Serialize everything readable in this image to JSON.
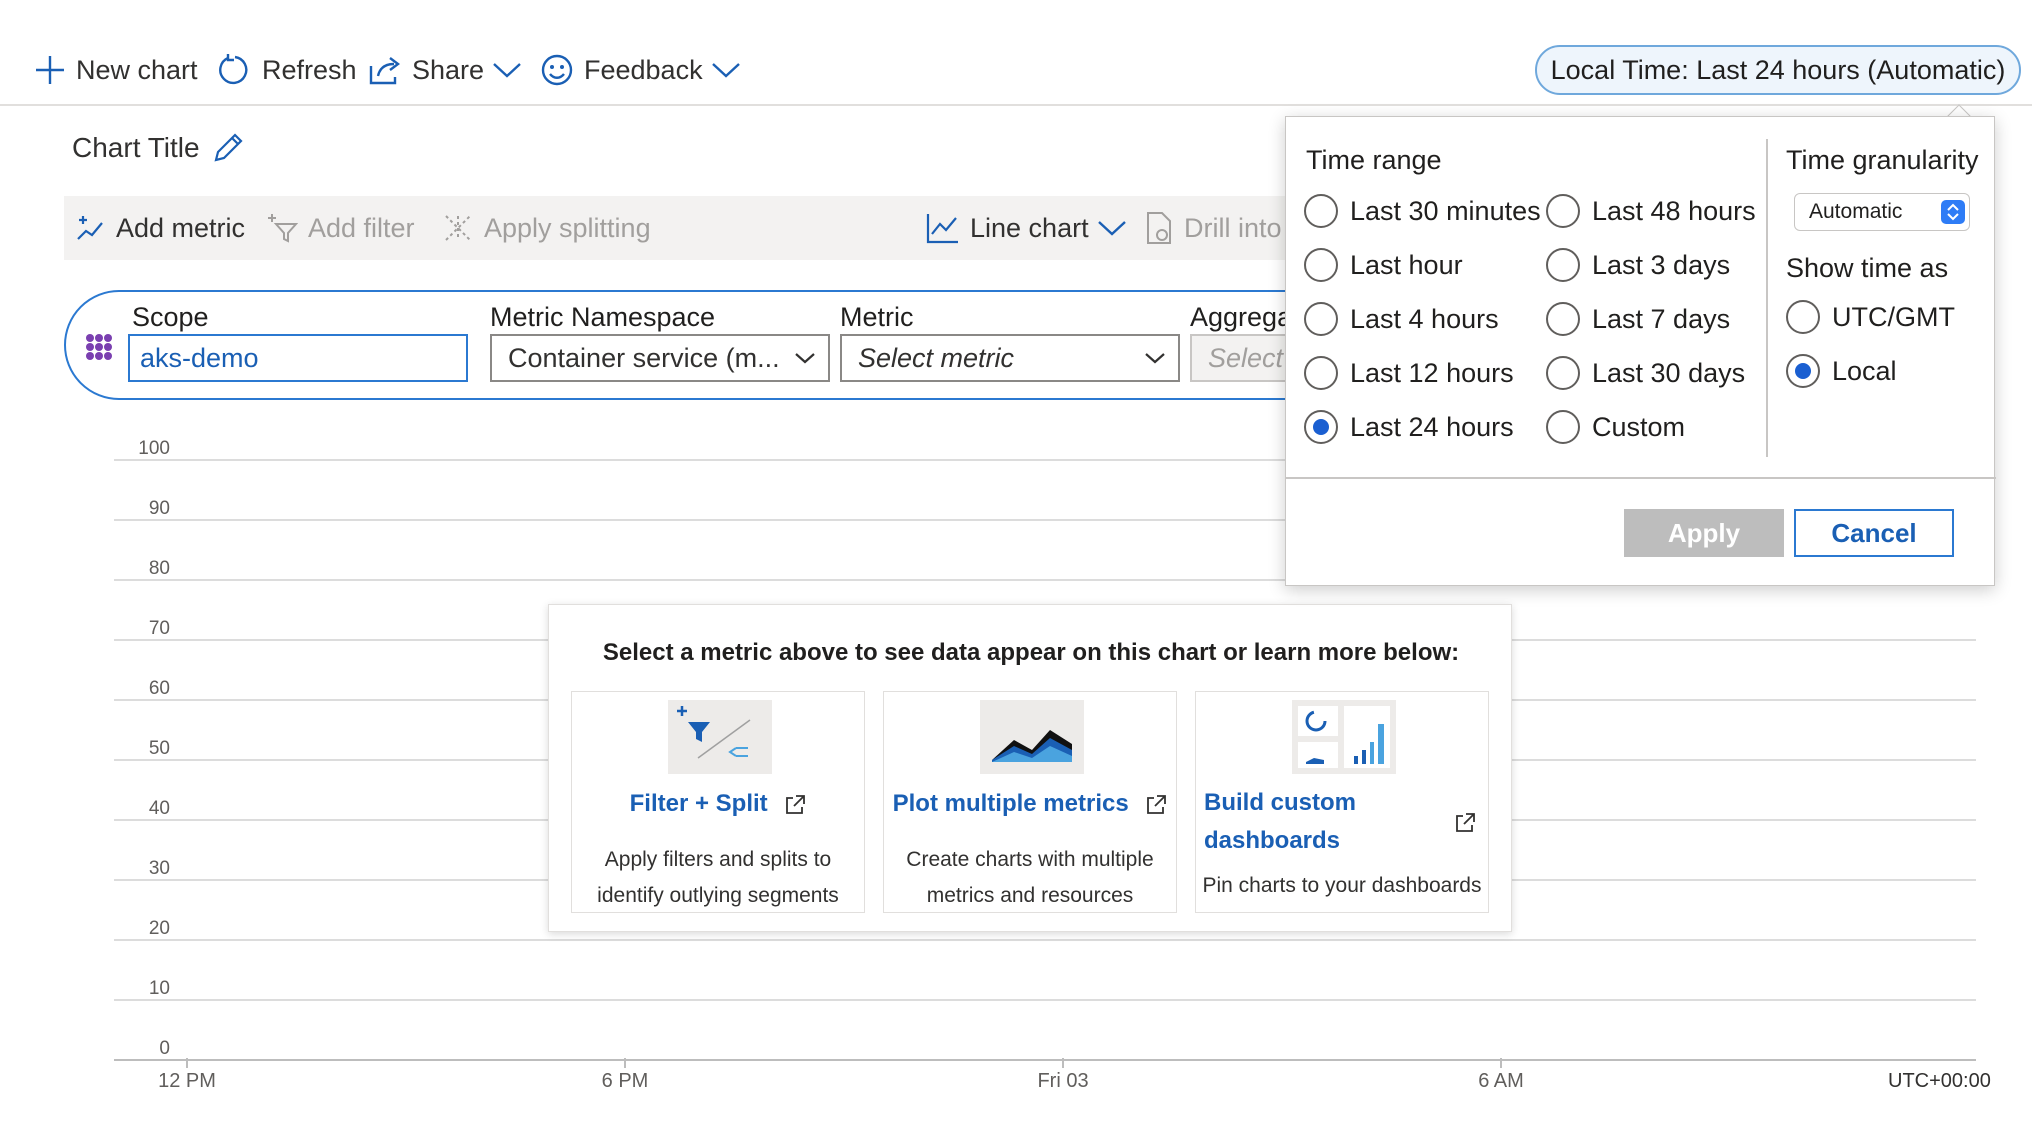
{
  "toolbar": {
    "new_chart": "New chart",
    "refresh": "Refresh",
    "share": "Share",
    "feedback": "Feedback",
    "time_pill": "Local Time: Last 24 hours (Automatic)"
  },
  "chart": {
    "title": "Chart Title"
  },
  "chart_toolbar": {
    "add_metric": "Add metric",
    "add_filter": "Add filter",
    "apply_splitting": "Apply splitting",
    "line_chart": "Line chart",
    "drill_into": "Drill into"
  },
  "metric_selector": {
    "scope_label": "Scope",
    "scope_value": "aks-demo",
    "namespace_label": "Metric Namespace",
    "namespace_value": "Container service (m...",
    "metric_label": "Metric",
    "metric_value": "Select metric",
    "aggregation_label": "Aggrega",
    "aggregation_value": "Select"
  },
  "axes": {
    "y_ticks": [
      "100",
      "90",
      "80",
      "70",
      "60",
      "50",
      "40",
      "30",
      "20",
      "10",
      "0"
    ],
    "x_ticks": [
      "12 PM",
      "6 PM",
      "Fri 03",
      "6 AM"
    ],
    "timezone": "UTC+00:00"
  },
  "empty_state": {
    "heading": "Select a metric above to see data appear on this chart or learn more below:",
    "tiles": [
      {
        "link": "Filter + Split",
        "desc": "Apply filters and splits to identify outlying segments"
      },
      {
        "link": "Plot multiple metrics",
        "desc": "Create charts with multiple metrics and resources"
      },
      {
        "link_line1": "Build custom",
        "link_line2": "dashboards",
        "desc": "Pin charts to your dashboards"
      }
    ]
  },
  "time_picker": {
    "time_range_heading": "Time range",
    "options_col1": [
      "Last 30 minutes",
      "Last hour",
      "Last 4 hours",
      "Last 12 hours",
      "Last 24 hours"
    ],
    "options_col2": [
      "Last 48 hours",
      "Last 3 days",
      "Last 7 days",
      "Last 30 days",
      "Custom"
    ],
    "selected": "Last 24 hours",
    "granularity_heading": "Time granularity",
    "granularity_value": "Automatic",
    "show_time_heading": "Show time as",
    "show_time_options": [
      "UTC/GMT",
      "Local"
    ],
    "show_time_selected": "Local",
    "apply": "Apply",
    "cancel": "Cancel"
  },
  "colors": {
    "accent": "#1a5fb4",
    "border_blue": "#2b79d1",
    "radio_fill": "#1a5fd1"
  }
}
